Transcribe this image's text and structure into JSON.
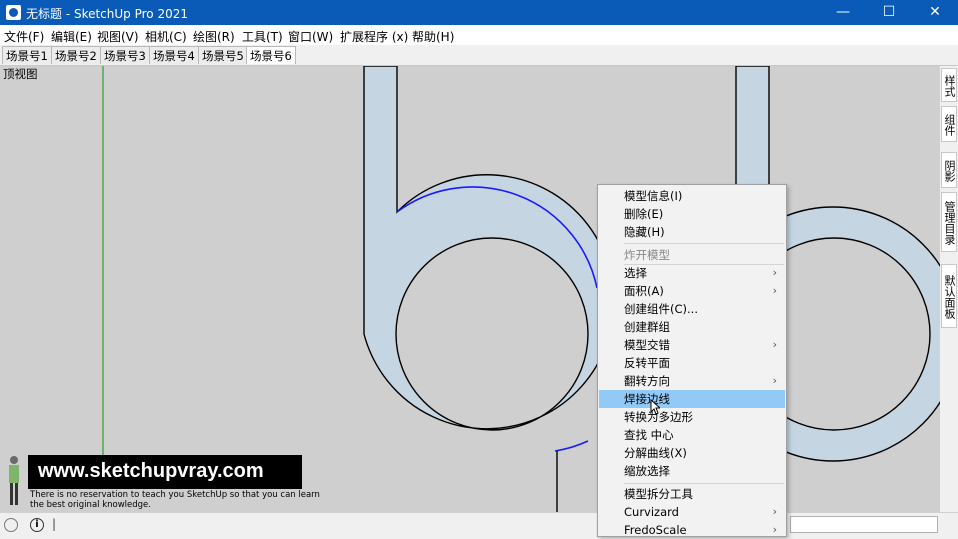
{
  "window": {
    "title": "无标题 - SketchUp Pro 2021",
    "minimize_glyph": "—",
    "maximize_glyph": "☐",
    "close_glyph": "✕",
    "app_icon": "sketchup-logo-icon"
  },
  "menubar": [
    "文件(F)",
    "编辑(E)",
    "视图(V)",
    "相机(C)",
    "绘图(R)",
    "工具(T)",
    "窗口(W)",
    "扩展程序 (x)",
    "帮助(H)"
  ],
  "scene_tabs": {
    "items": [
      "场景号1",
      "场景号2",
      "场景号3",
      "场景号4",
      "场景号5",
      "场景号6"
    ],
    "active": "场景号6"
  },
  "viewport": {
    "view_label": "顶视图",
    "background_color": "#cfcfcf",
    "shape_fill_color": "#c5d6e2",
    "selected_edge_color": "#1a1aff",
    "green_axis_color": "#2e9e2e"
  },
  "side_panel_tabs": [
    "样式",
    "组件",
    "阴影",
    "管理目录",
    "默认面板"
  ],
  "context_menu": {
    "items": [
      {
        "label": "模型信息(I)",
        "submenu": false,
        "disabled": false
      },
      {
        "label": "删除(E)",
        "submenu": false,
        "disabled": false
      },
      {
        "label": "隐藏(H)",
        "submenu": false,
        "disabled": false
      },
      {
        "label": "炸开模型",
        "submenu": false,
        "disabled": true
      },
      {
        "label": "选择",
        "submenu": true,
        "disabled": false
      },
      {
        "label": "面积(A)",
        "submenu": true,
        "disabled": false
      },
      {
        "label": "创建组件(C)...",
        "submenu": false,
        "disabled": false
      },
      {
        "label": "创建群组",
        "submenu": false,
        "disabled": false
      },
      {
        "label": "模型交错",
        "submenu": true,
        "disabled": false
      },
      {
        "label": "反转平面",
        "submenu": false,
        "disabled": false
      },
      {
        "label": "翻转方向",
        "submenu": true,
        "disabled": false
      },
      {
        "label": "焊接边线",
        "submenu": false,
        "disabled": false,
        "highlighted": true
      },
      {
        "label": "转换为多边形",
        "submenu": false,
        "disabled": false
      },
      {
        "label": "查找 中心",
        "submenu": false,
        "disabled": false
      },
      {
        "label": "分解曲线(X)",
        "submenu": false,
        "disabled": false
      },
      {
        "label": "缩放选择",
        "submenu": false,
        "disabled": false
      },
      {
        "label": "模型拆分工具",
        "submenu": false,
        "disabled": false
      },
      {
        "label": "Curvizard",
        "submenu": true,
        "disabled": false
      },
      {
        "label": "FredoScale",
        "submenu": true,
        "disabled": false
      }
    ],
    "submenu_glyph": "›",
    "highlight_color": "#91c9f7"
  },
  "watermark": {
    "url": "www.sketchupvray.com",
    "tagline": "There is no reservation to teach you SketchUp so that you can learn the best original knowledge."
  },
  "statusbar": {
    "icons": [
      "lightbulb-icon",
      "info-icon"
    ],
    "info_glyph": "i",
    "cursor_glyph": "|"
  }
}
